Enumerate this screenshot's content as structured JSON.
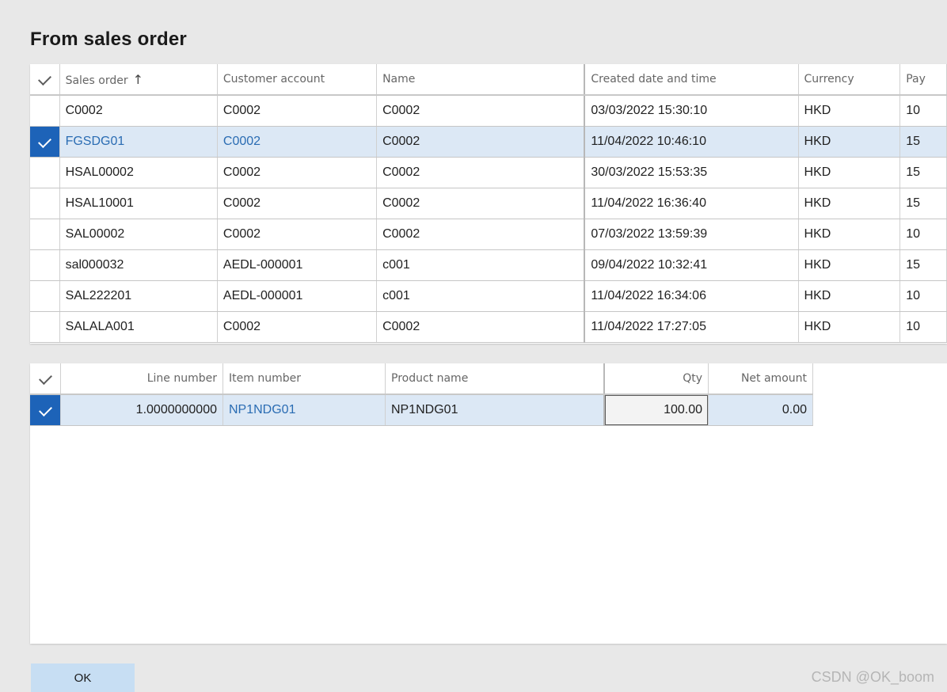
{
  "title": "From sales order",
  "orders": {
    "columns": [
      "Sales order",
      "Customer account",
      "Name",
      "Created date and time",
      "Currency",
      "Pay"
    ],
    "rows": [
      {
        "sales_order": "C0002",
        "customer_account": "C0002",
        "name": "C0002",
        "created": "03/03/2022 15:30:10",
        "currency": "HKD",
        "pay": "10"
      },
      {
        "sales_order": "FGSDG01",
        "customer_account": "C0002",
        "name": "C0002",
        "created": "11/04/2022 10:46:10",
        "currency": "HKD",
        "pay": "15"
      },
      {
        "sales_order": "HSAL00002",
        "customer_account": "C0002",
        "name": "C0002",
        "created": "30/03/2022 15:53:35",
        "currency": "HKD",
        "pay": "15"
      },
      {
        "sales_order": "HSAL10001",
        "customer_account": "C0002",
        "name": "C0002",
        "created": "11/04/2022 16:36:40",
        "currency": "HKD",
        "pay": "15"
      },
      {
        "sales_order": "SAL00002",
        "customer_account": "C0002",
        "name": "C0002",
        "created": "07/03/2022 13:59:39",
        "currency": "HKD",
        "pay": "10"
      },
      {
        "sales_order": "sal000032",
        "customer_account": "AEDL-000001",
        "name": "c001",
        "created": "09/04/2022 10:32:41",
        "currency": "HKD",
        "pay": "15"
      },
      {
        "sales_order": "SAL222201",
        "customer_account": "AEDL-000001",
        "name": "c001",
        "created": "11/04/2022 16:34:06",
        "currency": "HKD",
        "pay": "10"
      },
      {
        "sales_order": "SALALA001",
        "customer_account": "C0002",
        "name": "C0002",
        "created": "11/04/2022 17:27:05",
        "currency": "HKD",
        "pay": "10"
      }
    ],
    "selected_index": 1
  },
  "lines": {
    "columns": [
      "Line number",
      "Item number",
      "Product name",
      "Qty",
      "Net amount"
    ],
    "rows": [
      {
        "line_number": "1.0000000000",
        "item_number": "NP1NDG01",
        "product_name": "NP1NDG01",
        "qty": "100.00",
        "net_amount": "0.00"
      }
    ]
  },
  "ok_label": "OK",
  "watermark": "CSDN @OK_boom",
  "colors": {
    "accent": "#1d63b8",
    "selected_row": "#dce8f5",
    "link": "#2a6cb3",
    "button": "#c7def3"
  }
}
